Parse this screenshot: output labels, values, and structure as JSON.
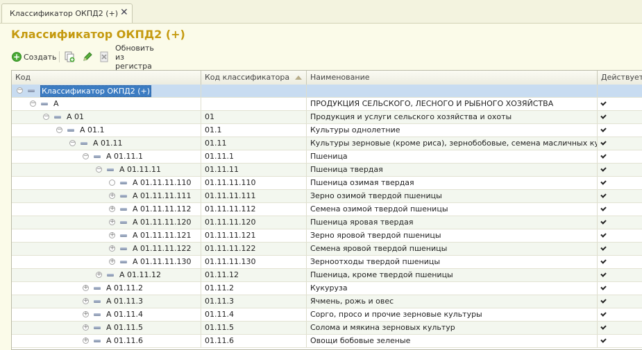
{
  "tab": {
    "label": "Классификатор ОКПД2 (+)",
    "close": "✕"
  },
  "page_title": "Классификатор ОКПД2 (+)",
  "toolbar": {
    "create_label": "Создать",
    "refresh_label": "Обновить из регистра"
  },
  "columns": {
    "code": "Код",
    "classifier_code": "Код классификатора",
    "name": "Наименование",
    "active": "Действует"
  },
  "rows": [
    {
      "code": "Классификатор ОКПД2 (+)",
      "cls": "",
      "name": "",
      "active": false,
      "level": 0,
      "expander": "minus"
    },
    {
      "code": "A",
      "cls": "",
      "name": "ПРОДУКЦИЯ СЕЛЬСКОГО, ЛЕСНОГО И РЫБНОГО ХОЗЯЙСТВА",
      "active": true,
      "level": 1,
      "expander": "minus"
    },
    {
      "code": "A 01",
      "cls": "01",
      "name": "Продукция и услуги сельского хозяйства и охоты",
      "active": true,
      "level": 2,
      "expander": "minus"
    },
    {
      "code": "A 01.1",
      "cls": "01.1",
      "name": "Культуры однолетние",
      "active": true,
      "level": 3,
      "expander": "minus"
    },
    {
      "code": "A 01.11",
      "cls": "01.11",
      "name": "Культуры зерновые (кроме риса), зернобобовые, семена масличных культур",
      "active": true,
      "level": 4,
      "expander": "minus"
    },
    {
      "code": "A 01.11.1",
      "cls": "01.11.1",
      "name": "Пшеница",
      "active": true,
      "level": 5,
      "expander": "minus"
    },
    {
      "code": "A 01.11.11",
      "cls": "01.11.11",
      "name": "Пшеница твердая",
      "active": true,
      "level": 6,
      "expander": "minus"
    },
    {
      "code": "A 01.11.11.110",
      "cls": "01.11.11.110",
      "name": "Пшеница озимая твердая",
      "active": true,
      "level": 7,
      "expander": "empty"
    },
    {
      "code": "A 01.11.11.111",
      "cls": "01.11.11.111",
      "name": "Зерно озимой твердой пшеницы",
      "active": true,
      "level": 7,
      "expander": "plus"
    },
    {
      "code": "A 01.11.11.112",
      "cls": "01.11.11.112",
      "name": "Семена озимой твердой пшеницы",
      "active": true,
      "level": 7,
      "expander": "plus"
    },
    {
      "code": "A 01.11.11.120",
      "cls": "01.11.11.120",
      "name": "Пшеница яровая твердая",
      "active": true,
      "level": 7,
      "expander": "plus"
    },
    {
      "code": "A 01.11.11.121",
      "cls": "01.11.11.121",
      "name": "Зерно яровой твердой пшеницы",
      "active": true,
      "level": 7,
      "expander": "plus"
    },
    {
      "code": "A 01.11.11.122",
      "cls": "01.11.11.122",
      "name": "Семена яровой твердой пшеницы",
      "active": true,
      "level": 7,
      "expander": "plus"
    },
    {
      "code": "A 01.11.11.130",
      "cls": "01.11.11.130",
      "name": "Зерноотходы твердой пшеницы",
      "active": true,
      "level": 7,
      "expander": "plus"
    },
    {
      "code": "A 01.11.12",
      "cls": "01.11.12",
      "name": "Пшеница, кроме твердой пшеницы",
      "active": true,
      "level": 6,
      "expander": "plus"
    },
    {
      "code": "A 01.11.2",
      "cls": "01.11.2",
      "name": "Кукуруза",
      "active": true,
      "level": 5,
      "expander": "plus"
    },
    {
      "code": "A 01.11.3",
      "cls": "01.11.3",
      "name": "Ячмень, рожь и овес",
      "active": true,
      "level": 5,
      "expander": "plus"
    },
    {
      "code": "A 01.11.4",
      "cls": "01.11.4",
      "name": "Сорго, просо и прочие зерновые культуры",
      "active": true,
      "level": 5,
      "expander": "plus"
    },
    {
      "code": "A 01.11.5",
      "cls": "01.11.5",
      "name": "Солома и мякина зерновых культур",
      "active": true,
      "level": 5,
      "expander": "plus"
    },
    {
      "code": "A 01.11.6",
      "cls": "01.11.6",
      "name": "Овощи бобовые зеленые",
      "active": true,
      "level": 5,
      "expander": "plus"
    }
  ]
}
